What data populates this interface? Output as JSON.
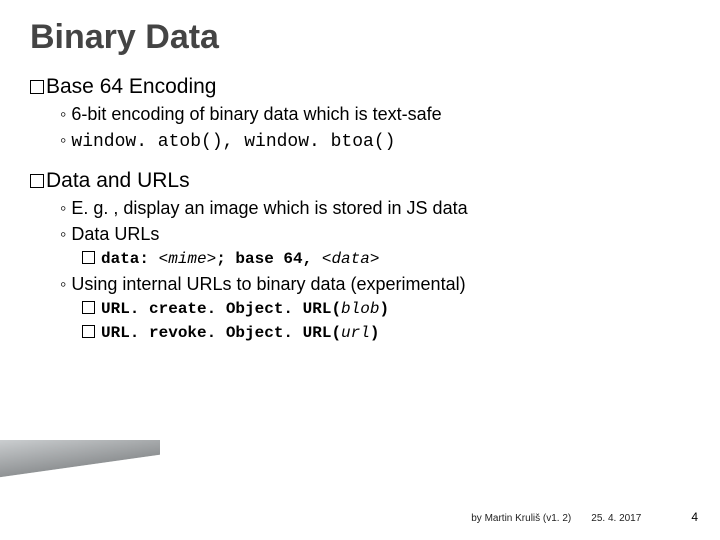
{
  "title": "Binary Data",
  "section1": {
    "head_prefix": "Base 64",
    "head_rest": " Encoding",
    "sub1_text": "6-bit encoding of binary data which is text-safe",
    "sub2_code": "window. atob(), window. btoa()"
  },
  "section2": {
    "head_prefix": "Data",
    "head_rest": " and URLs",
    "sub1_text": "E. g. , display an image which is stored in JS data",
    "sub2_text": "Data URLs",
    "sub2a_pre": "data: ",
    "sub2a_mime": "<mime>",
    "sub2a_mid": "; base 64, ",
    "sub2a_data": "<data>",
    "sub3_text": "Using internal URLs to binary data (experimental)",
    "sub3a_pre": "URL. create. Object. URL(",
    "sub3a_arg": "blob",
    "sub3a_post": ")",
    "sub3b_pre": "URL. revoke. Object. URL(",
    "sub3b_arg": "url",
    "sub3b_post": ")"
  },
  "footer": {
    "author": "by Martin Kruliš (v1. 2)",
    "date": "25. 4. 2017",
    "page": "4"
  }
}
